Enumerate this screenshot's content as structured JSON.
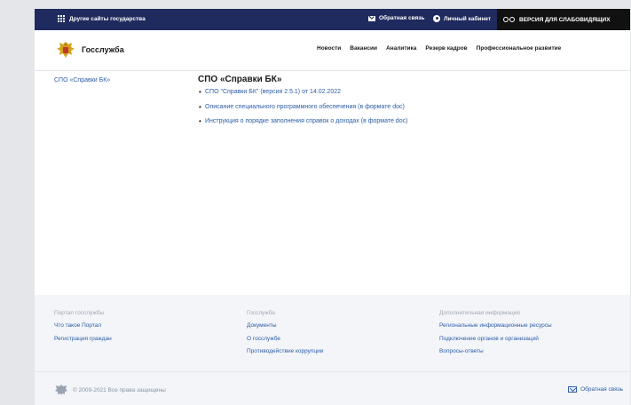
{
  "topbar": {
    "other_sites": "Другие сайты государства",
    "feedback": "Обратная связь",
    "cabinet": "Личный кабинет",
    "accessibility": "ВЕРСИЯ ДЛЯ СЛАБОВИДЯЩИХ"
  },
  "header": {
    "logo_text": "Госслужба",
    "nav": [
      "Новости",
      "Вакансии",
      "Аналитика",
      "Резерв кадров",
      "Профессиональное развитие"
    ]
  },
  "sidebar": {
    "active_item": "СПО «Справки БК»"
  },
  "main": {
    "title": "СПО «Справки БК»",
    "links": [
      "СПО \"Справки БК\" (версия 2.5.1) от 14.02.2022",
      "Описание специального программного обеспечения (в формате doc)",
      "Инструкция о порядке заполнения справок о доходах (в формате doc)"
    ]
  },
  "footer": {
    "col1": {
      "head": "Портал госслужбы",
      "links": [
        "Что такое Портал",
        "Регистрация граждан"
      ]
    },
    "col2": {
      "head": "Госслужба",
      "links": [
        "Документы",
        "О госслужбе",
        "Противодействие коррупции"
      ]
    },
    "col3": {
      "head": "Дополнительная информация",
      "links": [
        "Региональные информационные ресурсы",
        "Подключение органов и организаций",
        "Вопросы-ответы"
      ]
    },
    "copyright": "© 2009-2021 Все права защищены",
    "feedback": "Обратная связь"
  },
  "colors": {
    "topbar": "#1f2a5e",
    "link": "#2b5da8",
    "footer_bg": "#f3f5f8"
  }
}
